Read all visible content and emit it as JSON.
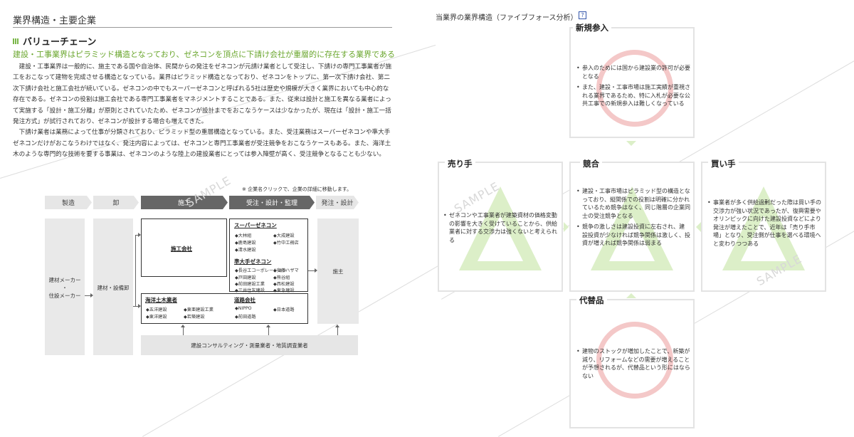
{
  "left": {
    "section_title": "業界構造・主要企業",
    "sub_title": "バリューチェーン",
    "lead": "建設・工事業界はピラミッド構造となっており、ゼネコンを頂点に下請け会社が重層的に存在する業界である",
    "paragraphs": [
      "建設・工事業界は一般的に、施主である国や自治体、民間からの発注をゼネコンが元請け業者として受注し、下請けの専門工事業者が施工をおこなって建物を完成させる構造となっている。業界はピラミッド構造となっており、ゼネコンをトップに、第一次下請け会社、第二次下請け会社と施工会社が続いている。ゼネコンの中でもスーパーゼネコンと呼ばれる5社は歴史や規模が大きく業界においても中心的な存在である。ゼネコンの役割は施工会社である専門工事業者をマネジメントすることである。また、従来は設計と施工を異なる業者によって実施する「設計・施工分離」が原則とされていたため、ゼネコンが設計までをおこなうケースは少なかったが、現在は「設計・施工一括発注方式」が試行されており、ゼネコンが設計する場合も増えてきた。",
      "下請け業者は業務によって仕事が分類されており、ピラミッド型の重層構造となっている。また、受注業務はスーパーゼネコンや準大手ゼネコンだけがおこなうわけではなく、発注内容によっては、ゼネコンと専門工事業者が受注競争をおこなうケースもある。また、海洋土木のような専門的な技術を要する事業は、ゼネコンのような陸上の建設業者にとっては参入障壁が高く、受注競争となることも少ない。"
    ],
    "note": "※ 企業名クリックで、企業の詳細に移動します。",
    "stages": [
      "製造",
      "卸",
      "施工",
      "受注・設計・監理",
      "発注・設計"
    ],
    "col1_label_a": "建材メーカー",
    "col1_label_dot": "・",
    "col1_label_b": "住設メーカー",
    "col2_label": "建材・設備卸",
    "owner_label": "施主",
    "builder_title": "施工会社",
    "super_title": "スーパーゼネコン",
    "super_cos": [
      "◆大林組",
      "◆大成建設",
      "◆鹿島建設",
      "◆竹中工務店",
      "◆清水建設"
    ],
    "semi_title": "準大手ゼネコン",
    "semi_cos": [
      "◆長谷工コーポレーション",
      "◆安藤ハザマ",
      "◆戸田建設",
      "◆熊谷組",
      "◆前田建設工業",
      "◆西松建設",
      "◆三井住友建設",
      "◆東急建設"
    ],
    "marine_title": "海洋土木業者",
    "marine_cos": [
      "◆五洋建設",
      "◆東亜建設工業",
      "◆東洋建設",
      "◆若築建設"
    ],
    "road_title": "道路会社",
    "road_cos": [
      "◆NIPPO",
      "◆日本道路",
      "◆前田道路"
    ],
    "consult": "建設コンサルティング・測量業者・地質調査業者",
    "watermark": "SAMPLE"
  },
  "right": {
    "title": "当業界の業界構造（ファイブフォース分析）",
    "help": "?",
    "new_entry": {
      "head": "新規参入",
      "items": [
        "参入のためには国から建設業の許可が必要となる",
        "また、建設・工事市場は施工実績が重視される業界であるため、特に入札が必要な公共工事での新規参入は難しくなっている"
      ]
    },
    "sellers": {
      "head": "売り手",
      "items": [
        "ゼネコンや工事業者が建築資材の価格変動の影響を大きく受けていることから、供給業者に対する交渉力は強くないと考えられる"
      ]
    },
    "rivalry": {
      "head": "競合",
      "items": [
        "建設・工事市場はピラミッド型の構造となっており、縦関係での役割は明確に分かれているため競争はなく、同じ階層の企業同士の受注競争となる",
        "競争の激しさは建設投資に左右され、建設投資が少なければ競争関係は激しく、投資が増えれば競争関係は弱まる"
      ]
    },
    "buyers": {
      "head": "買い手",
      "items": [
        "事業者が多く供給過剰だった際は買い手の交渉力が強い状況であったが、復興需要やオリンピックに向けた建設投資などにより発注が増えたことで、近年は「売り手市場」となり、受注側が仕事を選べる環境へと変わりつつある"
      ]
    },
    "substitutes": {
      "head": "代替品",
      "items": [
        "建物のストックが増加したことで、新築が減り、リフォームなどの需要が増えることが予想されるが、代替品という形にはならない"
      ]
    },
    "watermark": "SAMPLE"
  },
  "colors": {
    "accent_green": "#6aa62d",
    "circle_red": "#f4c8c8",
    "triangle_green": "#dcefc8"
  }
}
